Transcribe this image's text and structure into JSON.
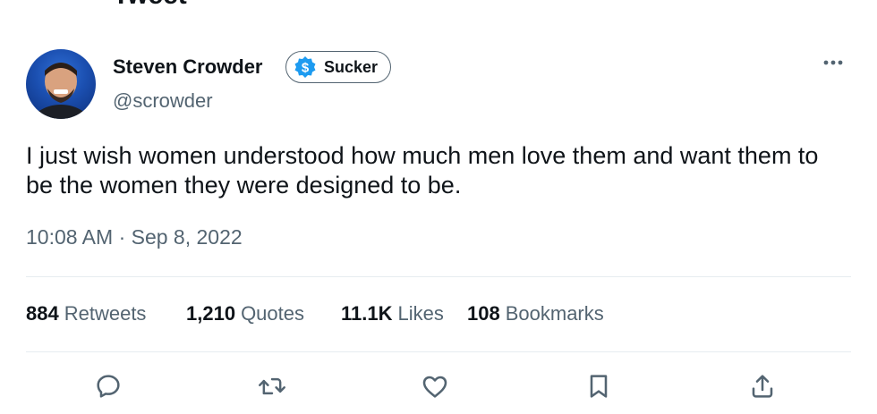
{
  "header": {
    "title": "Tweet"
  },
  "tweet": {
    "author_name": "Steven Crowder",
    "badge_label": "Sucker",
    "handle": "@scrowder",
    "text": "I just wish women understood how much men love them and want them to be the women they were designed to be.",
    "timestamp": "10:08 AM · Sep 8, 2022"
  },
  "stats": {
    "retweets_count": "884",
    "retweets_label": "Retweets",
    "quotes_count": "1,210",
    "quotes_label": "Quotes",
    "likes_count": "11.1K",
    "likes_label": "Likes",
    "bookmarks_count": "108",
    "bookmarks_label": "Bookmarks"
  },
  "icons": {
    "more": "more-icon",
    "reply": "reply-icon",
    "retweet": "retweet-icon",
    "like": "like-icon",
    "bookmark": "bookmark-icon",
    "share": "share-icon",
    "badge": "dollar-icon"
  },
  "colors": {
    "text": "#0f1419",
    "muted": "#536471",
    "badge_blue": "#1d9bf0",
    "divider": "#e6ecf0"
  }
}
